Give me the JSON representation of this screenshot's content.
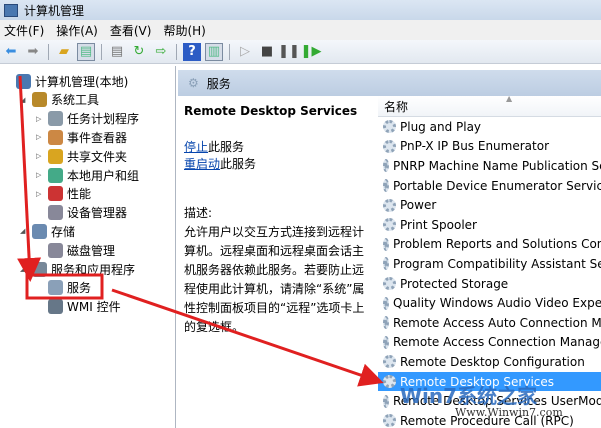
{
  "window": {
    "title": "计算机管理"
  },
  "menu": [
    "文件(F)",
    "操作(A)",
    "查看(V)",
    "帮助(H)"
  ],
  "toolbar": [
    "back-icon",
    "forward-icon",
    "up-folder-icon",
    "show-hide-tree-icon",
    "properties-icon",
    "refresh-icon",
    "export-icon",
    "help-icon",
    "action-pane-icon",
    "play-icon",
    "stop-icon",
    "pause-icon",
    "restart-icon"
  ],
  "tree": [
    {
      "label": "计算机管理(本地)",
      "level": 0,
      "exp": ""
    },
    {
      "label": "系统工具",
      "level": 1,
      "exp": "◢"
    },
    {
      "label": "任务计划程序",
      "level": 2,
      "exp": "▷"
    },
    {
      "label": "事件查看器",
      "level": 2,
      "exp": "▷"
    },
    {
      "label": "共享文件夹",
      "level": 2,
      "exp": "▷"
    },
    {
      "label": "本地用户和组",
      "level": 2,
      "exp": "▷"
    },
    {
      "label": "性能",
      "level": 2,
      "exp": "▷"
    },
    {
      "label": "设备管理器",
      "level": 2,
      "exp": ""
    },
    {
      "label": "存储",
      "level": 1,
      "exp": "◢"
    },
    {
      "label": "磁盘管理",
      "level": 2,
      "exp": ""
    },
    {
      "label": "服务和应用程序",
      "level": 1,
      "exp": "◢"
    },
    {
      "label": "服务",
      "level": 2,
      "exp": ""
    },
    {
      "label": "WMI 控件",
      "level": 2,
      "exp": ""
    }
  ],
  "pane": {
    "header": "服务",
    "service_title": "Remote Desktop Services",
    "stop_link": "停止",
    "stop_suffix": "此服务",
    "restart_link": "重启动",
    "restart_suffix": "此服务",
    "desc_label": "描述:",
    "desc": "允许用户以交互方式连接到远程计算机。远程桌面和远程桌面会话主机服务器依赖此服务。若要防止远程使用此计算机，请清除“系统”属性控制面板项目的“远程”选项卡上的复选框。"
  },
  "list": {
    "column": "名称",
    "rows": [
      "Plug and Play",
      "PnP-X IP Bus Enumerator",
      "PNRP Machine Name Publication Service",
      "Portable Device Enumerator Service",
      "Power",
      "Print Spooler",
      "Problem Reports and Solutions Control Panel Support",
      "Program Compatibility Assistant Service",
      "Protected Storage",
      "Quality Windows Audio Video Experience",
      "Remote Access Auto Connection Manager",
      "Remote Access Connection Manager",
      "Remote Desktop Configuration",
      "Remote Desktop Services",
      "Remote Desktop Services UserMode Port Redirector",
      "Remote Procedure Call (RPC)"
    ],
    "selected": 13
  },
  "watermark": {
    "logo": "Win7系统之家",
    "url": "Www.Winwin7.com"
  },
  "colors": {
    "annotation": "#e02020",
    "selection": "#3399ff"
  }
}
